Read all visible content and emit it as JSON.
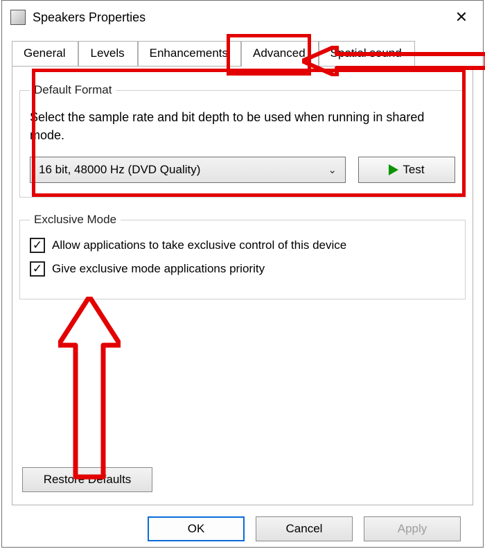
{
  "window": {
    "title": "Speakers Properties"
  },
  "tabs": [
    {
      "label": "General"
    },
    {
      "label": "Levels"
    },
    {
      "label": "Enhancements"
    },
    {
      "label": "Advanced",
      "active": true
    },
    {
      "label": "Spatial sound"
    }
  ],
  "defaultFormat": {
    "legend": "Default Format",
    "desc": "Select the sample rate and bit depth to be used when running in shared mode.",
    "selected": "16 bit, 48000 Hz (DVD Quality)",
    "testLabel": "Test"
  },
  "exclusiveMode": {
    "legend": "Exclusive Mode",
    "opt1": "Allow applications to take exclusive control of this device",
    "opt2": "Give exclusive mode applications priority"
  },
  "restoreLabel": "Restore Defaults",
  "buttons": {
    "ok": "OK",
    "cancel": "Cancel",
    "apply": "Apply"
  },
  "annotations": {
    "highlight_color": "#e20000"
  }
}
